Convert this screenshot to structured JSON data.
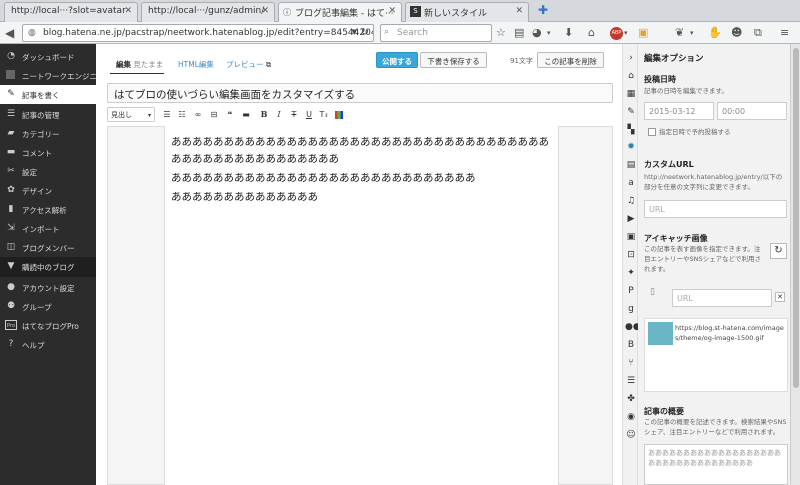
{
  "browser": {
    "tabs": [
      {
        "label": "http://local···?slot=avatar"
      },
      {
        "label": "http://local···/gunz/admin/"
      },
      {
        "label": "ブログ記事編集 - はて···"
      },
      {
        "label": "新しいスタイル"
      }
    ],
    "url": "blog.hatena.ne.jp/pacstrap/neetwork.hatenablog.jp/edit?entry=84544204500",
    "search_placeholder": "Search"
  },
  "sidebar": {
    "items": [
      {
        "label": "ダッシュボード",
        "icon": "speedometer-icon"
      },
      {
        "label": "ニートワークエンジニア",
        "icon": "blog-icon"
      },
      {
        "label": "記事を書く",
        "icon": "pencil-icon"
      },
      {
        "label": "記事の管理",
        "icon": "list-icon"
      },
      {
        "label": "カテゴリー",
        "icon": "folder-icon"
      },
      {
        "label": "コメント",
        "icon": "comment-icon"
      },
      {
        "label": "設定",
        "icon": "wrench-icon"
      },
      {
        "label": "デザイン",
        "icon": "palette-icon"
      },
      {
        "label": "アクセス解析",
        "icon": "chart-icon"
      },
      {
        "label": "インポート",
        "icon": "import-icon"
      },
      {
        "label": "ブログメンバー",
        "icon": "members-icon"
      },
      {
        "label": "購読中のブログ",
        "icon": "bookmark-icon"
      },
      {
        "label": "アカウント設定",
        "icon": "account-icon"
      },
      {
        "label": "グループ",
        "icon": "group-icon"
      },
      {
        "label": "はてなブログPro",
        "icon": "pro-icon"
      },
      {
        "label": "ヘルプ",
        "icon": "help-icon"
      }
    ]
  },
  "editor": {
    "tab_edit": "編集",
    "tab_edit_mode": "見たまま",
    "tab_html": "HTML編集",
    "tab_preview": "プレビュー",
    "publish": "公開する",
    "save_draft": "下書き保存する",
    "char_count": "91文字",
    "delete": "この記事を削除",
    "title": "はてブロの使いづらい編集画面をカスタマイズする",
    "heading_select": "見出し",
    "toolbar_labels": {
      "bold": "B",
      "italic": "I",
      "strike": "T",
      "underline": "U",
      "fontsize": "T"
    },
    "body": [
      "ああああああああああああああああああああああああああああああああああああああああああああああああああああ",
      "あああああああああああああああああああああああああああああ",
      "ああああああああああああああ"
    ]
  },
  "options": {
    "title": "編集オプション",
    "post_date_heading": "投稿日時",
    "post_date_desc": "記事の日時を編集できます。",
    "date_value": "2015-03-12",
    "time_value": "00:00",
    "schedule_label": "指定日時で予約投稿する",
    "custom_url_heading": "カスタムURL",
    "custom_url_desc": "http://neetwork.hatenablog.jp/entry/以下の部分を任意の文字列に変更できます。",
    "custom_url_placeholder": "URL",
    "eyecatch_heading": "アイキャッチ画像",
    "eyecatch_desc": "この記事を表す画像を指定できます。注目エントリーやSNSシェアなどで利用されます。",
    "eyecatch_url_placeholder": "URL",
    "eyecatch_image_url": "https://blog.st-hatena.com/images/theme/og-image-1500.gif",
    "summary_heading": "記事の概要",
    "summary_desc": "この記事の概要を記述できます。検索結果やSNSシェア、注目エントリーなどで利用されます。",
    "summary_value": "ああああああああああああああああああああああああああああああああああ"
  },
  "colors": {
    "accent": "#3aa6d9",
    "sidebar_bg": "#2c2c2c"
  }
}
